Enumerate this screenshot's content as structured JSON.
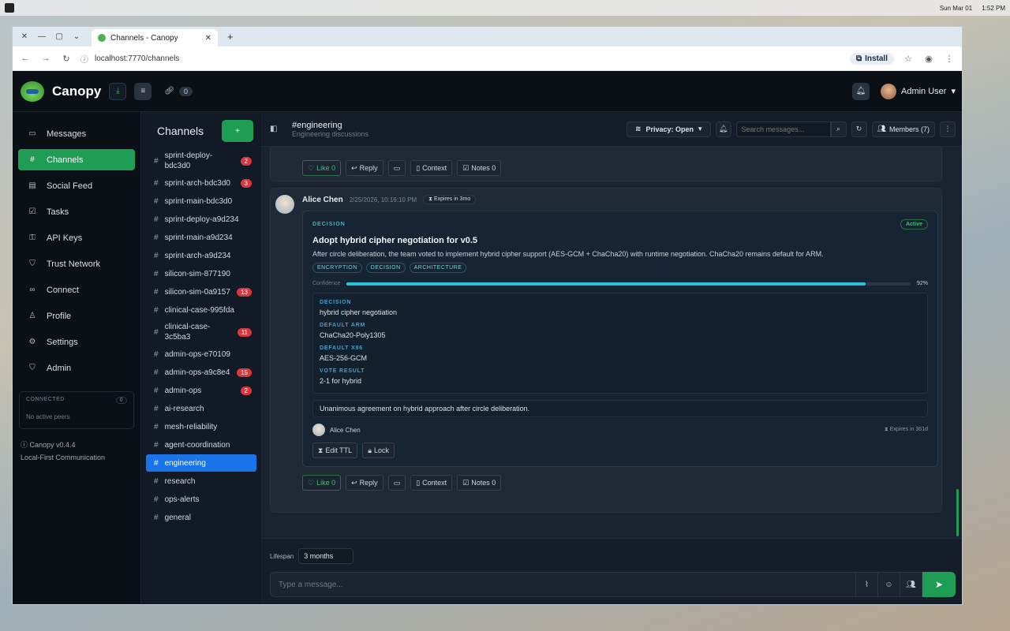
{
  "os": {
    "date": "Sun Mar 01",
    "time": "1:52 PM"
  },
  "browser": {
    "tab_title": "Channels - Canopy",
    "url": "localhost:7770/channels",
    "install_label": "Install"
  },
  "header": {
    "brand": "Canopy",
    "link_count": "0",
    "user_name": "Admin User"
  },
  "nav": {
    "items": [
      {
        "label": "Messages",
        "icon": "message-icon"
      },
      {
        "label": "Channels",
        "icon": "hash-icon"
      },
      {
        "label": "Social Feed",
        "icon": "feed-icon"
      },
      {
        "label": "Tasks",
        "icon": "checkbox-icon"
      },
      {
        "label": "API Keys",
        "icon": "key-icon"
      },
      {
        "label": "Trust Network",
        "icon": "shield-icon"
      },
      {
        "label": "Connect",
        "icon": "link-icon"
      },
      {
        "label": "Profile",
        "icon": "person-icon"
      },
      {
        "label": "Settings",
        "icon": "gear-icon"
      },
      {
        "label": "Admin",
        "icon": "shield-icon"
      }
    ],
    "connected_label": "CONNECTED",
    "connected_count": "0",
    "no_peers": "No active peers",
    "version": "Canopy v0.4.4",
    "tagline": "Local-First Communication"
  },
  "channels": {
    "title": "Channels",
    "add_label": "+",
    "list": [
      {
        "name": "sprint-deploy-bdc3d0",
        "badge": "2"
      },
      {
        "name": "sprint-arch-bdc3d0",
        "badge": "3"
      },
      {
        "name": "sprint-main-bdc3d0",
        "badge": ""
      },
      {
        "name": "sprint-deploy-a9d234",
        "badge": ""
      },
      {
        "name": "sprint-main-a9d234",
        "badge": ""
      },
      {
        "name": "sprint-arch-a9d234",
        "badge": ""
      },
      {
        "name": "silicon-sim-877190",
        "badge": ""
      },
      {
        "name": "silicon-sim-0a9157",
        "badge": "13"
      },
      {
        "name": "clinical-case-995fda",
        "badge": ""
      },
      {
        "name": "clinical-case-3c5ba3",
        "badge": "11"
      },
      {
        "name": "admin-ops-e70109",
        "badge": ""
      },
      {
        "name": "admin-ops-a9c8e4",
        "badge": "15"
      },
      {
        "name": "admin-ops",
        "badge": "2"
      },
      {
        "name": "ai-research",
        "badge": ""
      },
      {
        "name": "mesh-reliability",
        "badge": ""
      },
      {
        "name": "agent-coordination",
        "badge": ""
      },
      {
        "name": "engineering",
        "badge": ""
      },
      {
        "name": "research",
        "badge": ""
      },
      {
        "name": "ops-alerts",
        "badge": ""
      },
      {
        "name": "general",
        "badge": ""
      }
    ]
  },
  "main": {
    "channel_name": "#engineering",
    "channel_desc": "Engineering discussions",
    "privacy": "Privacy: Open",
    "search_placeholder": "Search messages...",
    "members": "Members (7)",
    "actions": {
      "like": "Like 0",
      "reply": "Reply",
      "context": "Context",
      "notes": "Notes 0"
    },
    "message": {
      "author": "Alice Chen",
      "time": "2/25/2026, 10:16:10 PM",
      "expires": "Expires in 3mo",
      "kicker": "DECISION",
      "status": "Active",
      "title": "Adopt hybrid cipher negotiation for v0.5",
      "body": "After circle deliberation, the team voted to implement hybrid cipher support (AES-GCM + ChaCha20) with runtime negotiation. ChaCha20 remains default for ARM.",
      "tags": [
        "ENCRYPTION",
        "DECISION",
        "ARCHITECTURE"
      ],
      "confidence_label": "Confidence",
      "confidence": 92,
      "confidence_text": "92%",
      "fields": [
        {
          "k": "DECISION",
          "v": "hybrid cipher negotiation"
        },
        {
          "k": "DEFAULT ARM",
          "v": "ChaCha20-Poly1305"
        },
        {
          "k": "DEFAULT X86",
          "v": "AES-256-GCM"
        },
        {
          "k": "VOTE RESULT",
          "v": "2-1 for hybrid"
        }
      ],
      "summary": "Unanimous agreement on hybrid approach after circle deliberation.",
      "signer": "Alice Chen",
      "signer_expires": "Expires in 361d",
      "edit_ttl": "Edit TTL",
      "lock": "Lock"
    }
  },
  "composer": {
    "lifespan_label": "Lifespan",
    "lifespan_value": "3 months",
    "placeholder": "Type a message..."
  }
}
